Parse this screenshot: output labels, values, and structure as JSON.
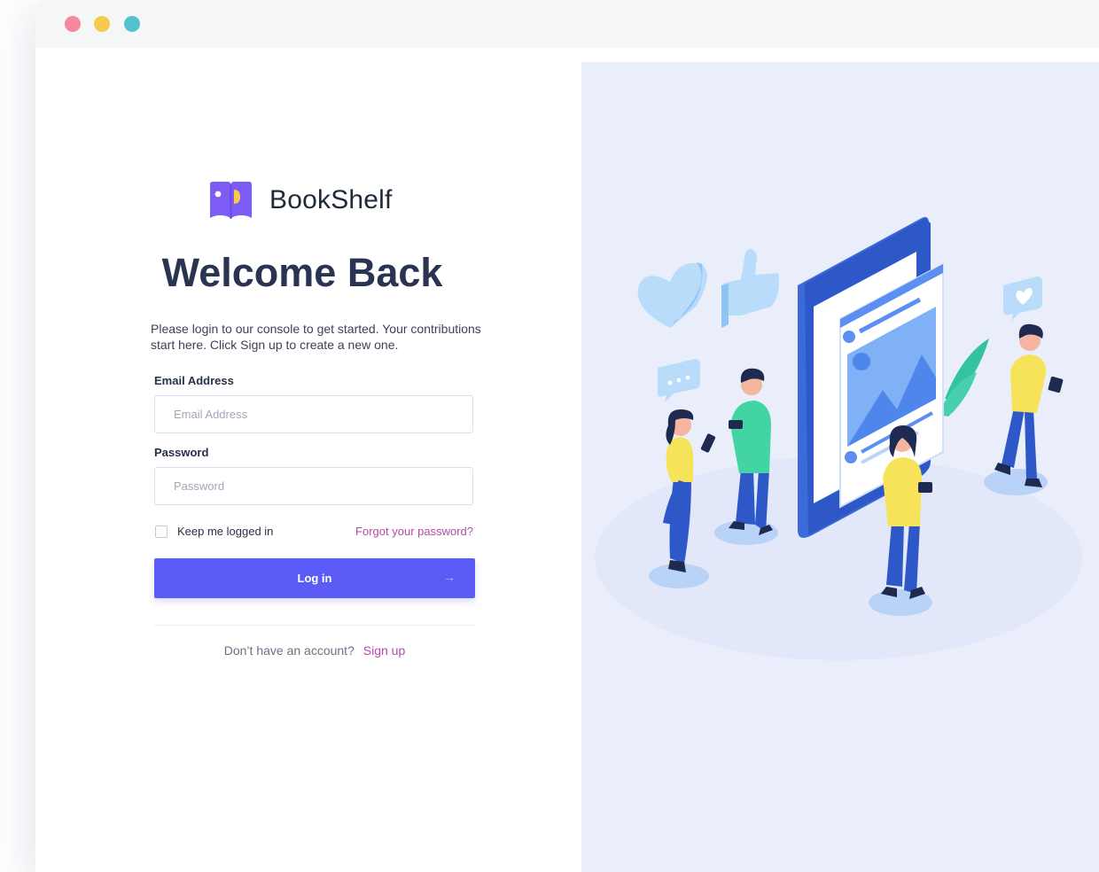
{
  "window": {
    "dots": [
      {
        "color": "#f7889c",
        "name": "close-dot"
      },
      {
        "color": "#f6c94f",
        "name": "minimize-dot"
      },
      {
        "color": "#52c2d3",
        "name": "maximize-dot"
      }
    ]
  },
  "brand": {
    "name_bold": "Book",
    "name_thin": "Shelf",
    "logo_icon": "open-book-icon",
    "logo_color": "#7c5cf5"
  },
  "login": {
    "title": "Welcome Back",
    "subtitle": "Please login to our console to get started. Your contributions start here. Click Sign up to create a new one.",
    "email_label": "Email Address",
    "email_placeholder": "Email Address",
    "email_value": "",
    "password_label": "Password",
    "password_placeholder": "Password",
    "password_value": "",
    "remember_label": "Keep me logged in",
    "remember_checked": false,
    "forgot_label": "Forgot your password?",
    "submit_label": "Log in",
    "submit_icon": "arrow-right-icon",
    "signup_prompt": "Don’t have an account?",
    "signup_label": "Sign up"
  },
  "colors": {
    "accent": "#5b5cf6",
    "link": "#b54aa8",
    "illustration_bg": "#eaeefa"
  },
  "illustration": {
    "icon": "social-media-people-illustration"
  }
}
